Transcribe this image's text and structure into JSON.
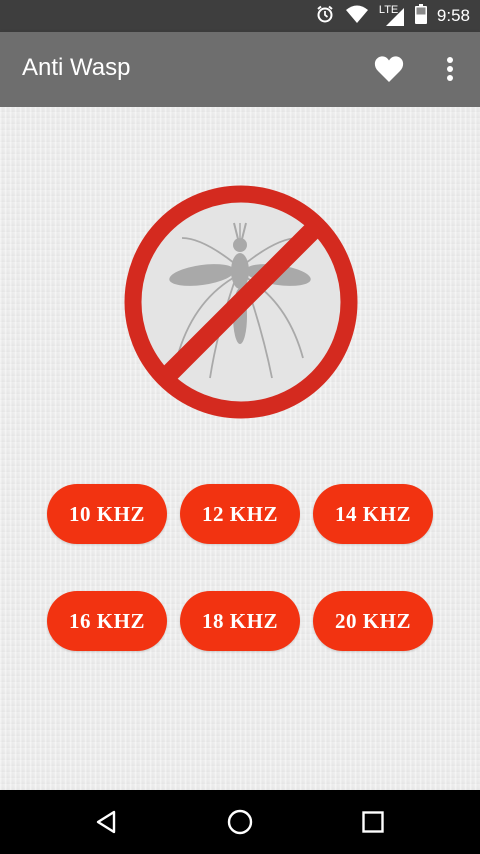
{
  "status_bar": {
    "time": "9:58",
    "network_label": "LTE",
    "icons": [
      "alarm-icon",
      "wifi-icon",
      "signal-icon",
      "battery-icon"
    ]
  },
  "app_bar": {
    "title": "Anti Wasp",
    "favorite_icon": "heart-icon",
    "menu_icon": "more-vertical-icon"
  },
  "main": {
    "hero_icon": "no-wasp-icon",
    "frequency_buttons": [
      {
        "label": "10 KHZ"
      },
      {
        "label": "12 KHZ"
      },
      {
        "label": "14 KHZ"
      },
      {
        "label": "16 KHZ"
      },
      {
        "label": "18 KHZ"
      },
      {
        "label": "20 KHZ"
      }
    ]
  },
  "nav_bar": {
    "icons": [
      "back-icon",
      "home-icon",
      "recents-icon"
    ]
  },
  "colors": {
    "button": "#f23311",
    "prohibition_ring": "#d42a1f",
    "app_bar": "#6e6e6e",
    "status_bar": "#3e3e3e"
  }
}
